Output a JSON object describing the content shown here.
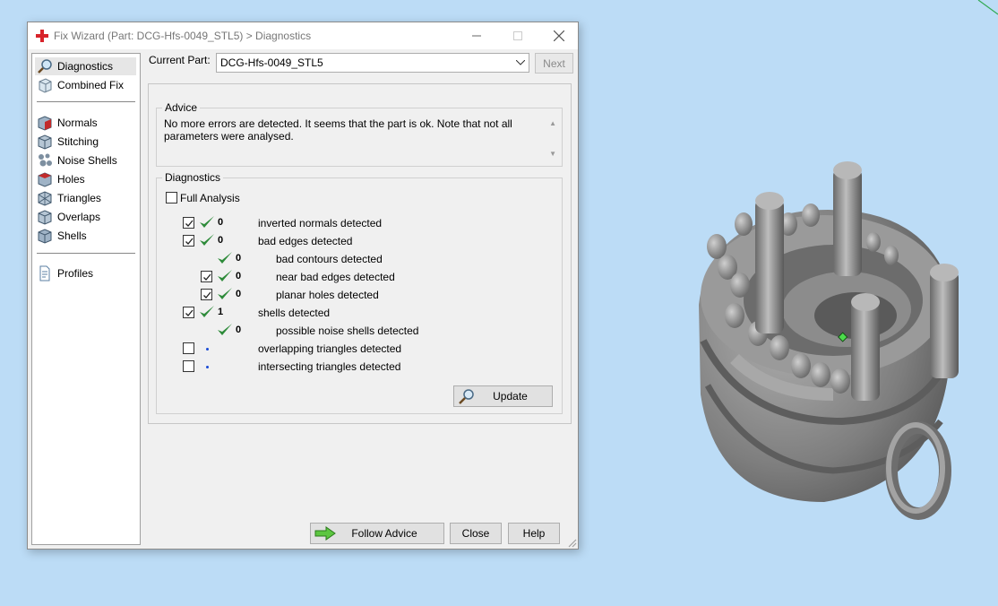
{
  "window": {
    "title": "Fix Wizard (Part: DCG-Hfs-0049_STL5) > Diagnostics"
  },
  "sidebar": {
    "items": [
      {
        "label": "Diagnostics",
        "icon": "magnifier-icon",
        "selected": true
      },
      {
        "label": "Combined Fix",
        "icon": "cube-icon"
      },
      {
        "label": "Normals",
        "icon": "normals-cube-icon"
      },
      {
        "label": "Stitching",
        "icon": "stitching-cube-icon"
      },
      {
        "label": "Noise Shells",
        "icon": "noise-shells-icon"
      },
      {
        "label": "Holes",
        "icon": "holes-cube-icon"
      },
      {
        "label": "Triangles",
        "icon": "triangles-cube-icon"
      },
      {
        "label": "Overlaps",
        "icon": "overlaps-cube-icon"
      },
      {
        "label": "Shells",
        "icon": "shells-cube-icon"
      },
      {
        "label": "Profiles",
        "icon": "profiles-document-icon"
      }
    ]
  },
  "current_part": {
    "label": "Current Part:",
    "value": "DCG-Hfs-0049_STL5"
  },
  "next_button": "Next",
  "advice": {
    "title": "Advice",
    "line1": "No more errors are detected. It seems that the part is ok. Note that not all",
    "line2": "parameters were analysed."
  },
  "diagnostics": {
    "title": "Diagnostics",
    "full_analysis_label": "Full Analysis",
    "full_analysis_checked": false,
    "rows": [
      {
        "checkbox": true,
        "checked": true,
        "status": "ok",
        "count": "0",
        "label": "inverted normals detected",
        "indent": 0
      },
      {
        "checkbox": true,
        "checked": true,
        "status": "ok",
        "count": "0",
        "label": "bad edges detected",
        "indent": 0
      },
      {
        "checkbox": false,
        "checked": false,
        "status": "ok",
        "count": "0",
        "label": "bad contours detected",
        "indent": 1
      },
      {
        "checkbox": true,
        "checked": true,
        "status": "ok",
        "count": "0",
        "label": "near bad edges detected",
        "indent": 1
      },
      {
        "checkbox": true,
        "checked": true,
        "status": "ok",
        "count": "0",
        "label": "planar holes detected",
        "indent": 1
      },
      {
        "checkbox": true,
        "checked": true,
        "status": "ok",
        "count": "1",
        "label": "shells detected",
        "indent": 0
      },
      {
        "checkbox": false,
        "checked": false,
        "status": "ok",
        "count": "0",
        "label": "possible noise shells detected",
        "indent": 1
      },
      {
        "checkbox": true,
        "checked": false,
        "status": "none",
        "count": "",
        "label": "overlapping triangles detected",
        "indent": 0
      },
      {
        "checkbox": true,
        "checked": false,
        "status": "none",
        "count": "",
        "label": "intersecting triangles detected",
        "indent": 0
      }
    ],
    "update_button": "Update"
  },
  "footer": {
    "follow_advice": "Follow Advice",
    "close": "Close",
    "help": "Help"
  },
  "colors": {
    "background": "#bcdcf6",
    "check_green": "#2e8b3a",
    "model_gray": "#8d8d8d"
  }
}
